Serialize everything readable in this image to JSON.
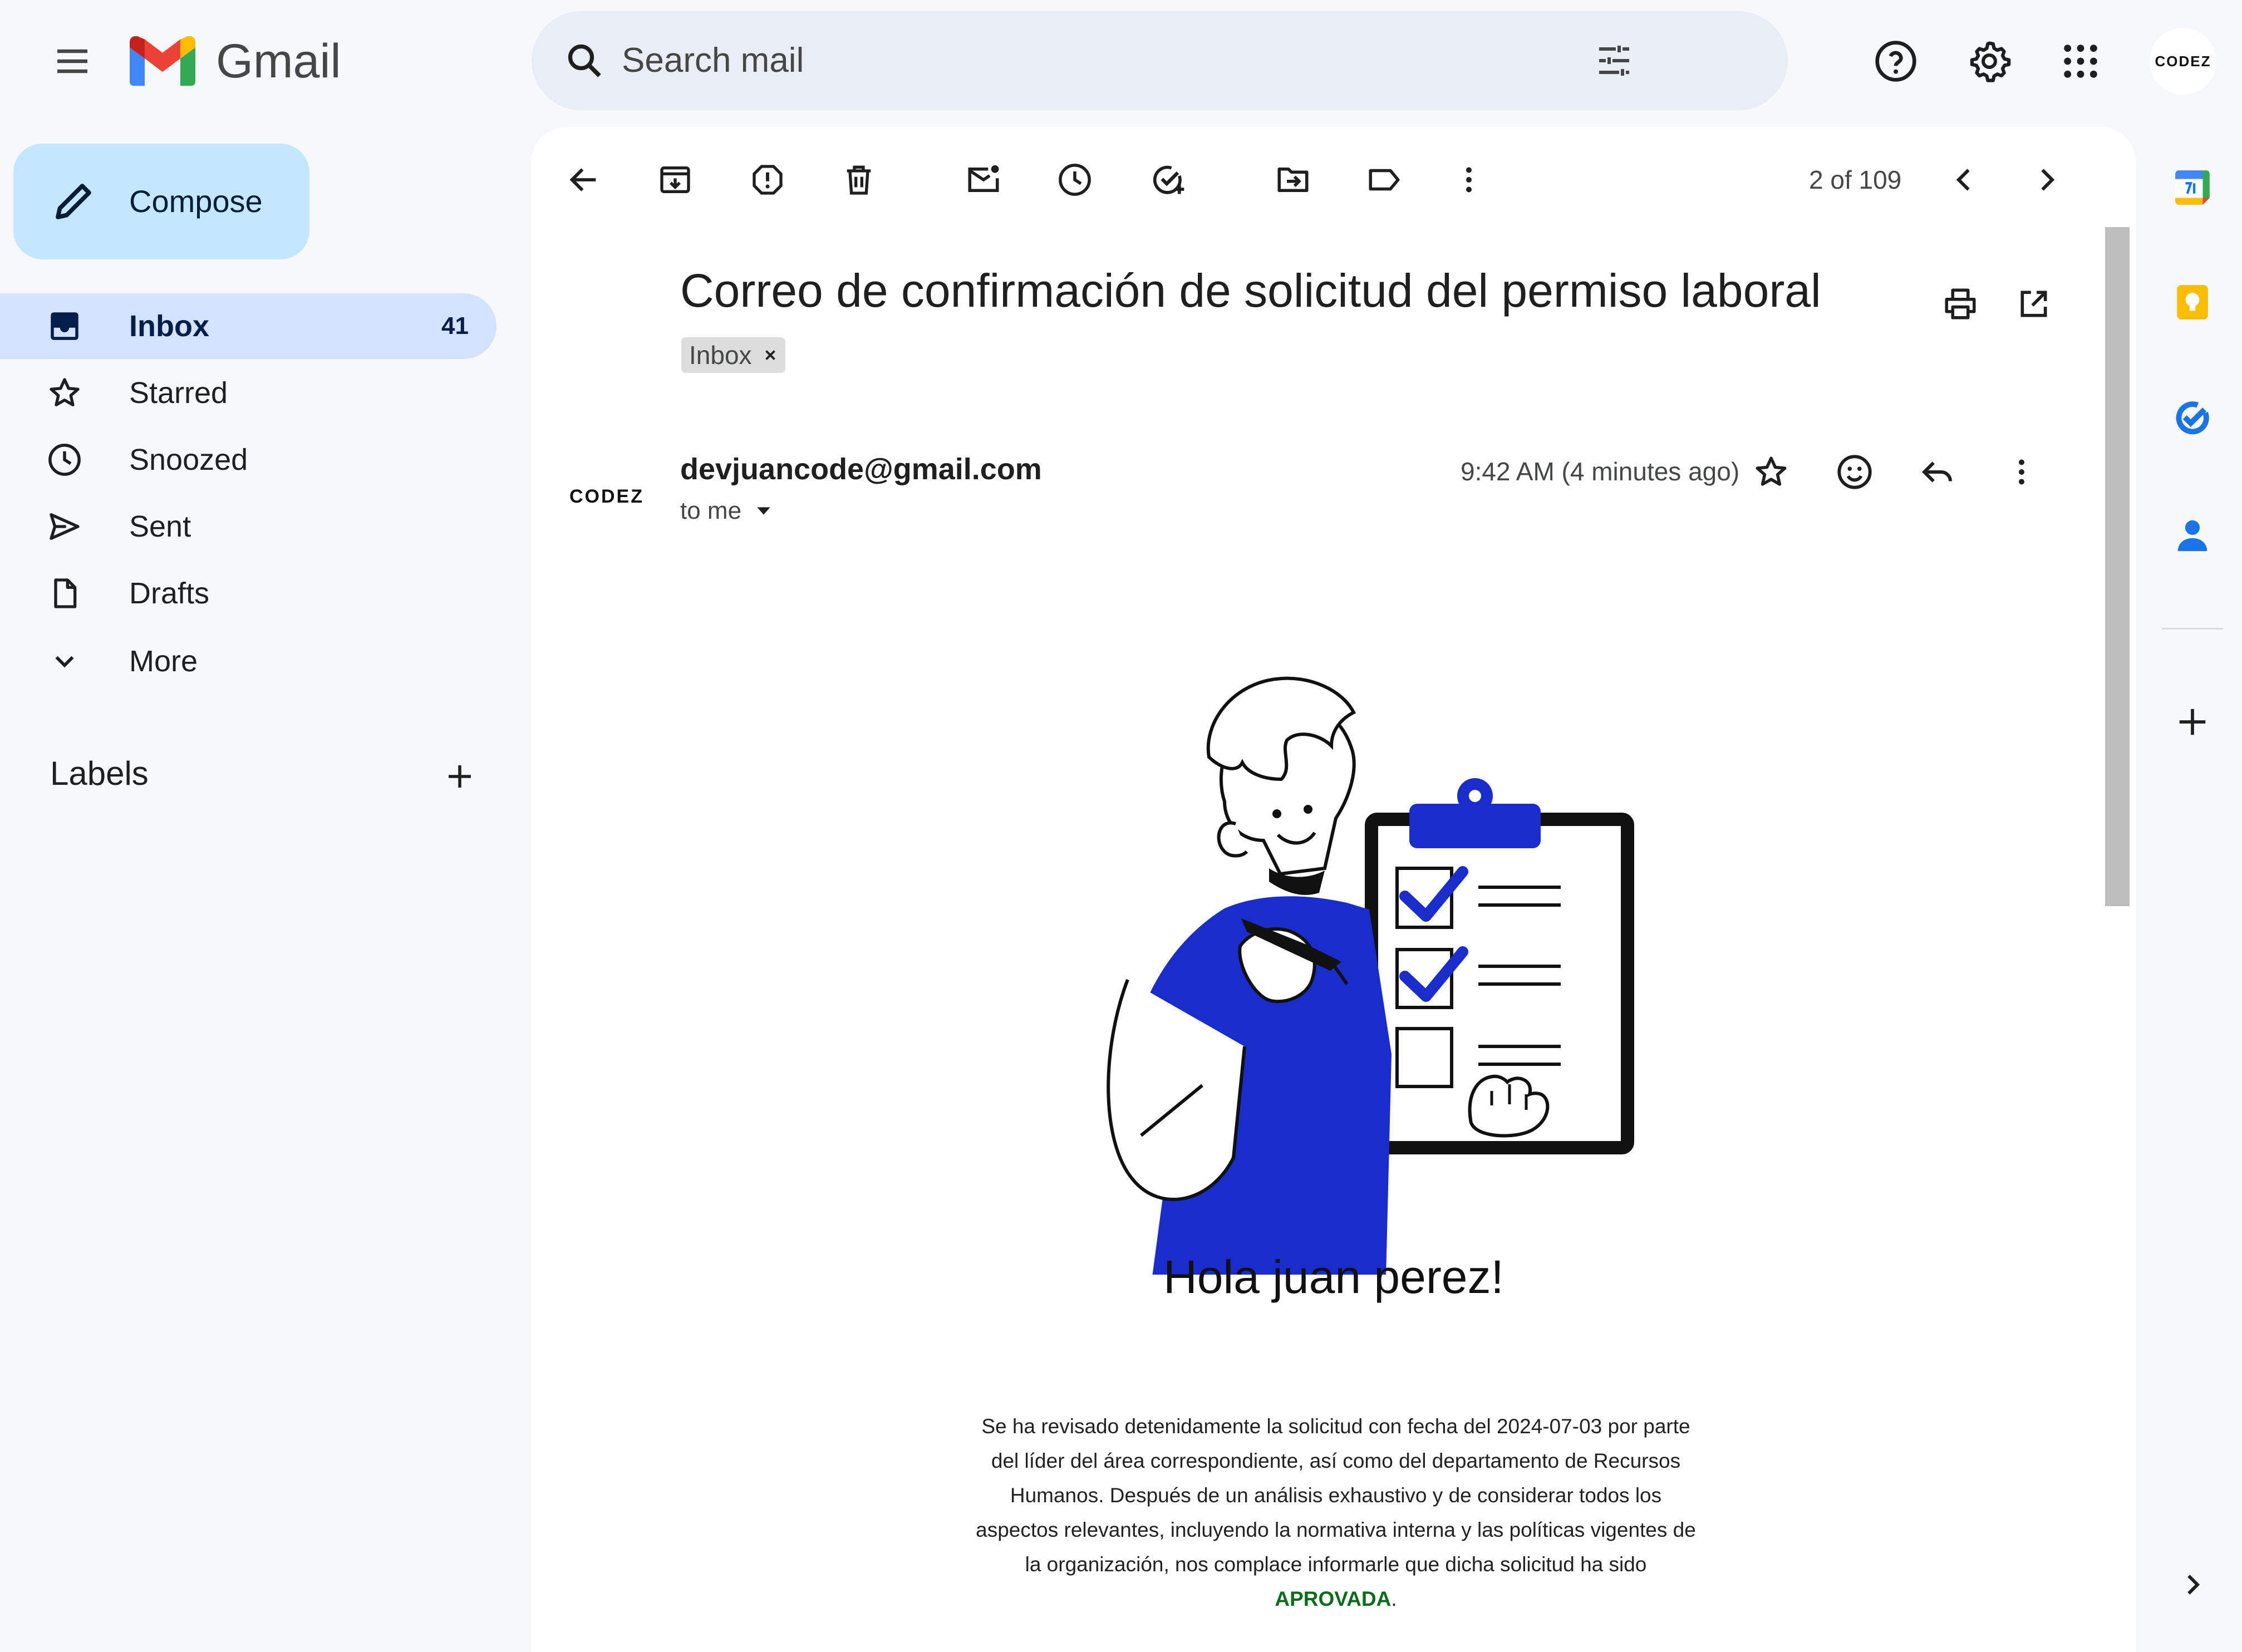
{
  "header": {
    "brand": "Gmail",
    "search_placeholder": "Search mail",
    "avatar_text": "CODEZ"
  },
  "sidebar": {
    "compose_label": "Compose",
    "items": [
      {
        "label": "Inbox",
        "count": "41",
        "icon": "inbox-icon",
        "active": true
      },
      {
        "label": "Starred",
        "count": "",
        "icon": "star-icon"
      },
      {
        "label": "Snoozed",
        "count": "",
        "icon": "clock-icon"
      },
      {
        "label": "Sent",
        "count": "",
        "icon": "send-icon"
      },
      {
        "label": "Drafts",
        "count": "",
        "icon": "draft-icon"
      },
      {
        "label": "More",
        "count": "",
        "icon": "chevron-down-icon"
      }
    ],
    "labels_title": "Labels"
  },
  "toolbar": {
    "pager": "2 of 109"
  },
  "message": {
    "subject": "Correo de confirmación de solicitud del permiso laboral",
    "label_chip": "Inbox",
    "sender_avatar_text": "CODEZ",
    "sender": "devjuancode@gmail.com",
    "recipient": "to me",
    "time": "9:42 AM (4 minutes ago)",
    "greeting": "Hola juan perez!",
    "body": "Se ha revisado detenidamente la solicitud con fecha del 2024-07-03 por parte del líder del área correspondiente, así como del departamento de Recursos Humanos. Después de un análisis exhaustivo y de considerar todos los aspectos relevantes, incluyendo la normativa interna y las políticas vigentes de la organización, nos complace informarle que dicha solicitud ha sido",
    "status_word": "APROVADA",
    "status_suffix": "."
  },
  "colors": {
    "accent_blue": "#1a2ccc",
    "approved_green": "#0b6b1d",
    "compose_bg": "#c2e7ff",
    "active_bg": "#d3e3fd"
  }
}
